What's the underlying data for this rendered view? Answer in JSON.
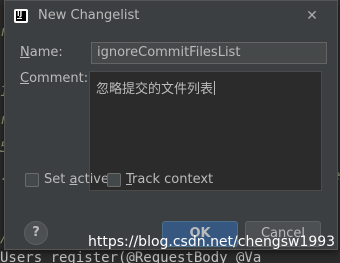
{
  "dialog": {
    "title": "New Changelist",
    "close_glyph": "✕",
    "icon": "intellij-app-icon"
  },
  "form": {
    "name_label_pre": "",
    "name_label_mnemonic": "N",
    "name_label_post": "ame:",
    "name_value": "ignoreCommitFilesList",
    "comment_label_pre": "",
    "comment_label_mnemonic": "C",
    "comment_label_post": "omment:",
    "comment_value": "忽略提交的文件列表"
  },
  "options": {
    "set_active_pre": "Set ",
    "set_active_mnemonic": "a",
    "set_active_post": "ctive",
    "track_context_pre": "",
    "track_context_mnemonic": "T",
    "track_context_post": "rack context"
  },
  "buttons": {
    "help": "?",
    "ok": "OK",
    "cancel": "Cancel"
  },
  "watermark": "https://blog.csdn.net/chengsw1993",
  "background": {
    "bottom_line": "Users register(@RequestBody @Va"
  },
  "colors": {
    "dialog_bg": "#3c3f41",
    "ok_button_bg": "#365880",
    "text": "#bbbbbb"
  }
}
